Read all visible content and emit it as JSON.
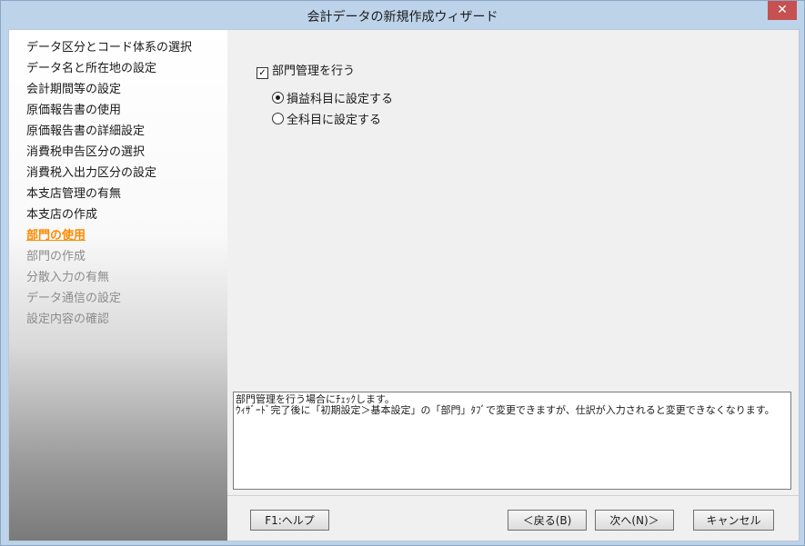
{
  "window": {
    "title": "会計データの新規作成ウィザード",
    "close_glyph": "✕"
  },
  "steps": [
    {
      "label": "データ区分とコード体系の選択",
      "state": "normal"
    },
    {
      "label": "データ名と所在地の設定",
      "state": "normal"
    },
    {
      "label": "会計期間等の設定",
      "state": "normal"
    },
    {
      "label": "原価報告書の使用",
      "state": "normal"
    },
    {
      "label": "原価報告書の詳細設定",
      "state": "normal"
    },
    {
      "label": "消費税申告区分の選択",
      "state": "normal"
    },
    {
      "label": "消費税入出力区分の設定",
      "state": "normal"
    },
    {
      "label": "本支店管理の有無",
      "state": "normal"
    },
    {
      "label": "本支店の作成",
      "state": "normal"
    },
    {
      "label": "部門の使用",
      "state": "current"
    },
    {
      "label": "部門の作成",
      "state": "disabled"
    },
    {
      "label": "分散入力の有無",
      "state": "disabled"
    },
    {
      "label": "データ通信の設定",
      "state": "disabled"
    },
    {
      "label": "設定内容の確認",
      "state": "disabled"
    }
  ],
  "options": {
    "checkbox_label": "部門管理を行う",
    "checkbox_checked": true,
    "checkbox_mark": "✓",
    "radio1_label": "損益科目に設定する",
    "radio1_selected": true,
    "radio2_label": "全科目に設定する",
    "radio2_selected": false
  },
  "help": {
    "line1": "部門管理を行う場合にﾁｪｯｸします。",
    "line2": "ｳｨｻﾞｰﾄﾞ完了後に「初期設定＞基本設定」の「部門」ﾀﾌﾞで変更できますが、仕訳が入力されると変更できなくなります。"
  },
  "buttons": {
    "help": "F1:ヘルプ",
    "back": "＜戻る(B)",
    "next": "次へ(N)＞",
    "cancel": "キャンセル"
  }
}
